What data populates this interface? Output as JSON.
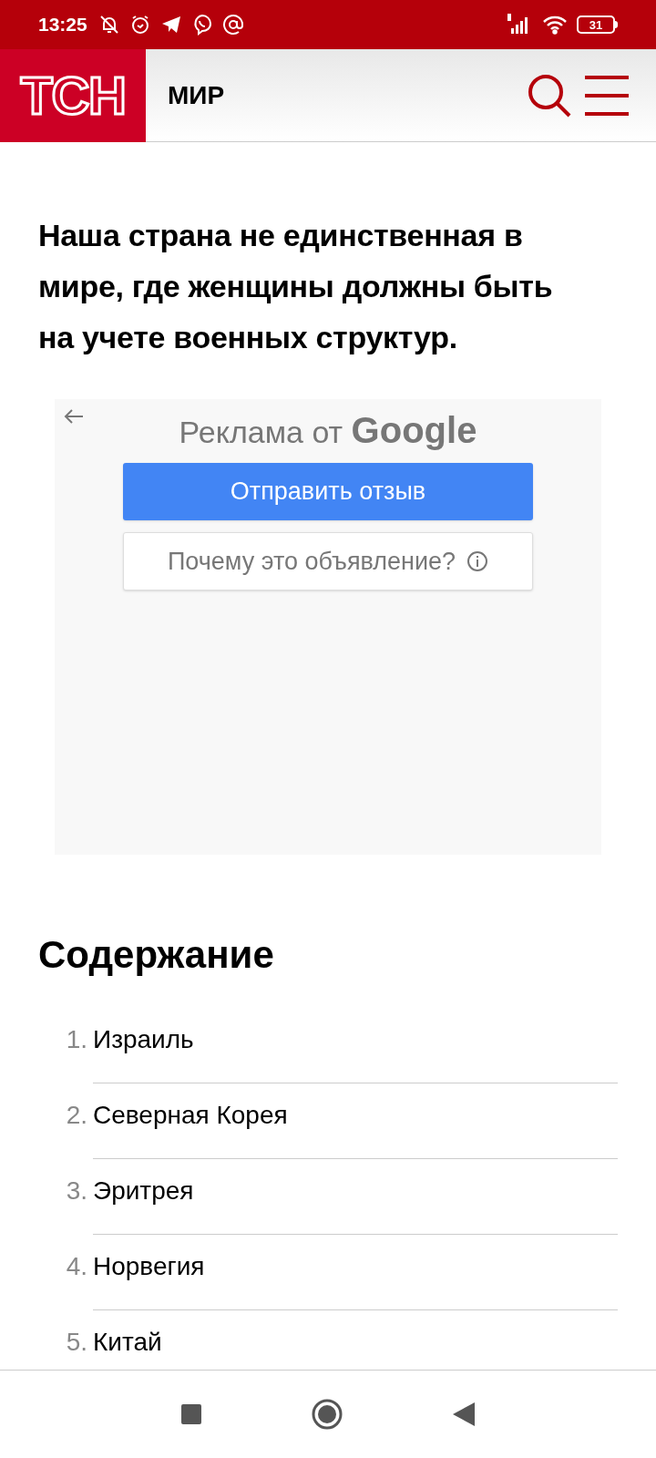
{
  "status_bar": {
    "time": "13:25",
    "battery": "31"
  },
  "header": {
    "logo": "ТСН",
    "section": "МИР"
  },
  "paragraph": "Наша страна не единственная в мире, где женщины должны быть на учете военных структур.",
  "ad": {
    "title_prefix": "Реклама от",
    "title_brand": "Google",
    "feedback_button": "Отправить отзыв",
    "why_button": "Почему это объявление?"
  },
  "contents": {
    "title": "Содержание",
    "items": [
      {
        "number": "1.",
        "label": "Израиль"
      },
      {
        "number": "2.",
        "label": "Северная Корея"
      },
      {
        "number": "3.",
        "label": "Эритрея"
      },
      {
        "number": "4.",
        "label": "Норвегия"
      },
      {
        "number": "5.",
        "label": "Китай"
      }
    ]
  }
}
